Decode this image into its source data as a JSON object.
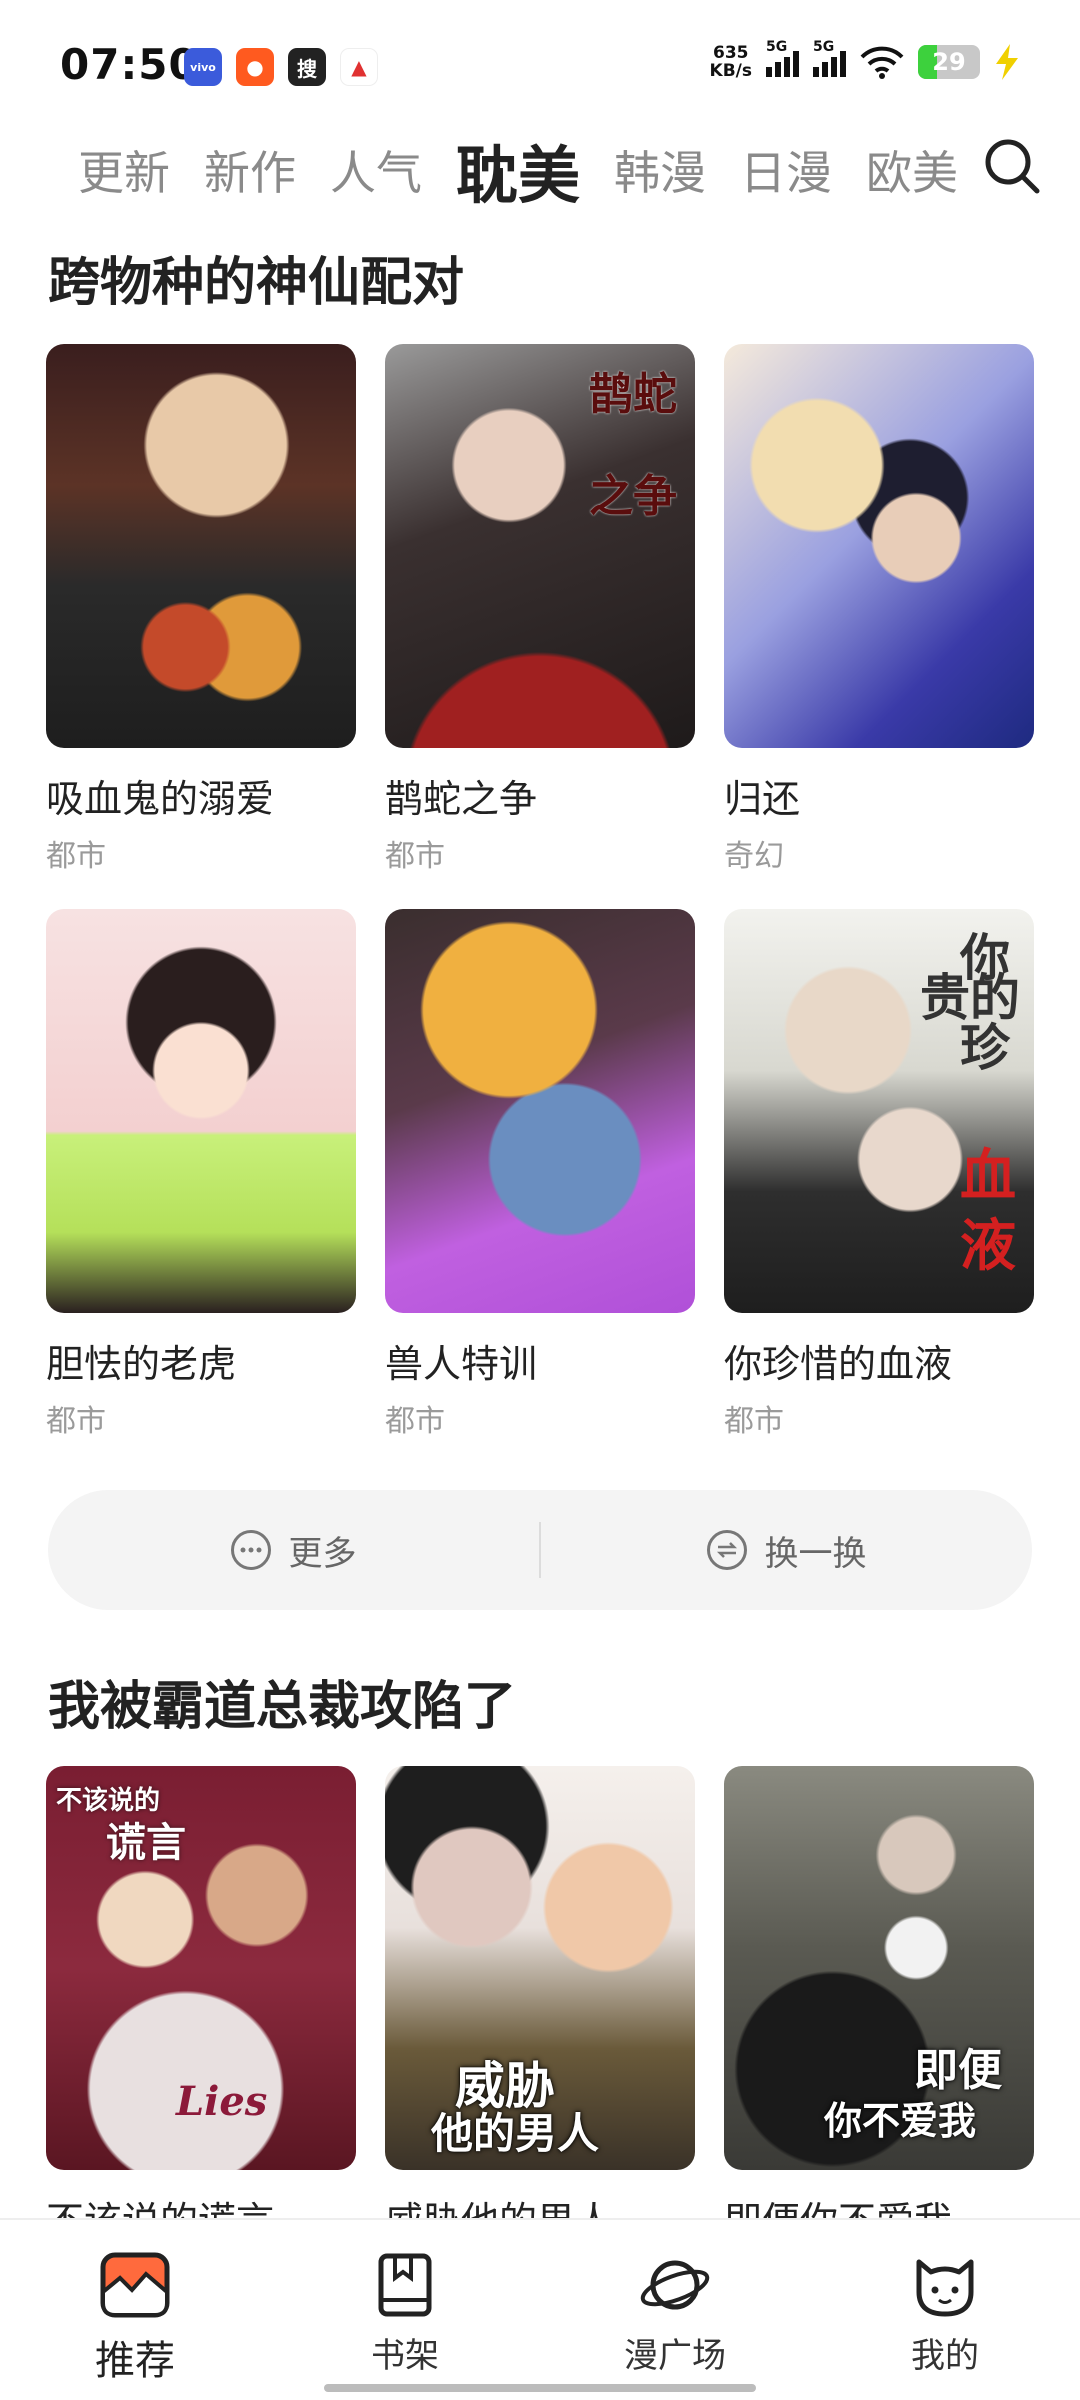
{
  "status_bar": {
    "time": "07:50",
    "net_speed_value": "635",
    "net_speed_unit": "KB/s",
    "signal1_label": "5G",
    "signal2_label": "5G",
    "battery_level": "29",
    "app_icons": [
      "vivo",
      "store",
      "搜",
      "app"
    ]
  },
  "tabs": [
    {
      "label": "更新",
      "active": false
    },
    {
      "label": "新作",
      "active": false
    },
    {
      "label": "人气",
      "active": false
    },
    {
      "label": "耽美",
      "active": true
    },
    {
      "label": "韩漫",
      "active": false
    },
    {
      "label": "日漫",
      "active": false
    },
    {
      "label": "欧美",
      "active": false
    }
  ],
  "section1": {
    "title": "跨物种的神仙配对",
    "items": [
      {
        "title": "吸血鬼的溺爱",
        "genre": "都市"
      },
      {
        "title": "鹊蛇之争",
        "genre": "都市"
      },
      {
        "title": "归还",
        "genre": "奇幻"
      },
      {
        "title": "胆怯的老虎",
        "genre": "都市"
      },
      {
        "title": "兽人特训",
        "genre": "都市"
      },
      {
        "title": "你珍惜的血液",
        "genre": "都市"
      }
    ],
    "cover_texts": {
      "c2a": "鹊蛇",
      "c2b": "之争",
      "c6a": "你珍",
      "c6b": "贵的",
      "c6c": "血液"
    }
  },
  "actions": {
    "more_label": "更多",
    "refresh_label": "换一换"
  },
  "section2": {
    "title": "我被霸道总裁攻陷了",
    "items": [
      {
        "title": "不该说的谎言"
      },
      {
        "title": "威胁他的男人"
      },
      {
        "title": "即便你不爱我"
      }
    ],
    "cover_texts": {
      "c1a": "不该说的",
      "c1b": "谎言",
      "c1c": "Lies",
      "c2a": "威胁",
      "c2b": "他的男人",
      "c3a": "即便",
      "c3b": "你不爱我"
    }
  },
  "bottom_nav": [
    {
      "label": "推荐",
      "active": true
    },
    {
      "label": "书架",
      "active": false
    },
    {
      "label": "漫广场",
      "active": false
    },
    {
      "label": "我的",
      "active": false
    }
  ],
  "colors": {
    "accent": "#ff6a3d",
    "active_tab": "#222222",
    "inactive_tab": "#8a8a8a",
    "genre": "#9a9a9a"
  }
}
